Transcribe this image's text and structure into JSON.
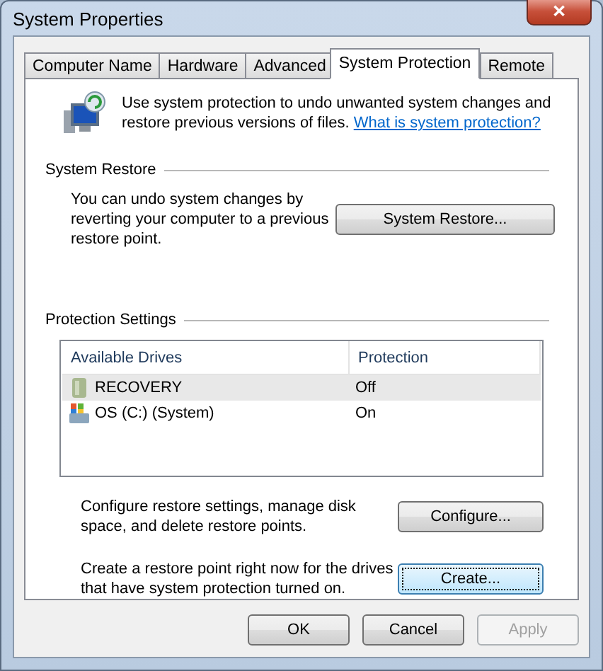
{
  "window": {
    "title": "System Properties",
    "close": "✕"
  },
  "tabs": [
    {
      "label": "Computer Name",
      "selected": false
    },
    {
      "label": "Hardware",
      "selected": false
    },
    {
      "label": "Advanced",
      "selected": false
    },
    {
      "label": "System Protection",
      "selected": true
    },
    {
      "label": "Remote",
      "selected": false
    }
  ],
  "intro": {
    "text": "Use system protection to undo unwanted system changes and restore previous versions of files.",
    "link": "What is system protection?"
  },
  "system_restore": {
    "heading": "System Restore",
    "text": "You can undo system changes by reverting your computer to a previous restore point.",
    "button": {
      "label": "System Restore...",
      "focused": false,
      "disabled": false
    }
  },
  "protection_settings": {
    "heading": "Protection Settings",
    "columns": [
      "Available Drives",
      "Protection"
    ],
    "rows": [
      {
        "kind": "recovery",
        "drive": "RECOVERY",
        "protection": "Off",
        "selected": true
      },
      {
        "kind": "system",
        "drive": "OS (C:) (System)",
        "protection": "On",
        "selected": false
      }
    ],
    "actions": [
      {
        "text": "Configure restore settings, manage disk space, and delete restore points.",
        "button": {
          "label": "Configure...",
          "focused": false,
          "disabled": false
        }
      },
      {
        "text": "Create a restore point right now for the drives that have system protection turned on.",
        "button": {
          "label": "Create...",
          "focused": true,
          "disabled": false
        }
      }
    ]
  },
  "buttons": [
    {
      "label": "OK",
      "focused": false,
      "disabled": false
    },
    {
      "label": "Cancel",
      "focused": false,
      "disabled": false
    },
    {
      "label": "Apply",
      "focused": false,
      "disabled": true
    }
  ]
}
